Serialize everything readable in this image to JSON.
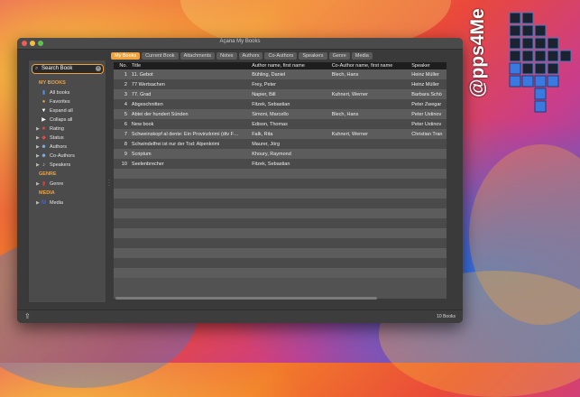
{
  "window": {
    "title": "Açana My Books"
  },
  "search": {
    "value": "Search Book"
  },
  "sidebar": {
    "sections": [
      {
        "header": "MY BOOKS",
        "items": [
          {
            "label": "All books",
            "icon": "book-icon",
            "color": "#4f8fe0"
          },
          {
            "label": "Favorites",
            "icon": "heart-icon",
            "color": "#f0a23a"
          },
          {
            "label": "Expand all",
            "icon": "triangle-down-icon",
            "color": "#ffffff"
          },
          {
            "label": "Collaps all",
            "icon": "triangle-right-icon",
            "color": "#ffffff"
          },
          {
            "label": "Rating",
            "icon": "rating-icon",
            "color": "#e0534a",
            "expandable": true
          },
          {
            "label": "Status",
            "icon": "status-icon",
            "color": "#e84a3a",
            "expandable": true
          },
          {
            "label": "Authors",
            "icon": "authors-icon",
            "color": "#7ab6f0",
            "expandable": true
          },
          {
            "label": "Co-Authors",
            "icon": "co-authors-icon",
            "color": "#7ab6f0",
            "expandable": true
          },
          {
            "label": "Speakers",
            "icon": "speakers-icon",
            "color": "#cccccc",
            "expandable": true
          }
        ]
      },
      {
        "header": "GENRE",
        "items": [
          {
            "label": "Genre",
            "icon": "genre-icon",
            "color": "#e03a3a",
            "expandable": true
          }
        ]
      },
      {
        "header": "MEDIA",
        "items": [
          {
            "label": "Media",
            "icon": "media-icon",
            "color": "#4f6fe0",
            "expandable": true
          }
        ]
      }
    ]
  },
  "tabs": [
    "My Books",
    "Current Book",
    "Attachments",
    "Notes",
    "Authors",
    "Co-Authors",
    "Speakers",
    "Genre",
    "Media"
  ],
  "table": {
    "columns": [
      "No.",
      "Title",
      "Author name, first name",
      "Co-Author name, first name",
      "Speaker"
    ],
    "rows": [
      [
        "1",
        "11. Gebot",
        "Bühling, Daniel",
        "Blech, Hans",
        "Heinz Müller"
      ],
      [
        "2",
        "77 Wertsachen",
        "Frey, Peter",
        "",
        "Heinz Müller"
      ],
      [
        "3",
        "77. Grad",
        "Napier, Bill",
        "Kuhnert, Werner",
        "Barbara Schö"
      ],
      [
        "4",
        "Abgeschnitten",
        "Fitzek, Sebastian",
        "",
        "Peter Zwegar"
      ],
      [
        "5",
        "Abtei der hundert Sünden",
        "Simoni, Marcello",
        "Blech, Hans",
        "Peter Ustinov"
      ],
      [
        "6",
        "New book",
        "Edison, Thomas",
        "",
        "Peter Ustinov"
      ],
      [
        "7",
        "Schweinskopf al dente: Ein Provinzkrimi (dtv F…",
        "Falk, Rita",
        "Kuhnert, Werner",
        "Christian Tran"
      ],
      [
        "8",
        "Schwindelfrei ist nur der Tod: Alpenkrimi",
        "Maurer, Jörg",
        "",
        ""
      ],
      [
        "9",
        "Scriptum",
        "Khoury, Raymond",
        "",
        ""
      ],
      [
        "10",
        "Seelenbrecher",
        "Fitzek, Sebastian",
        "",
        ""
      ]
    ],
    "empty_rows": 11
  },
  "status": {
    "count": "10 Books"
  },
  "logo": {
    "text": "@pps4Me"
  },
  "colors": {
    "accent": "#f0a23a"
  }
}
